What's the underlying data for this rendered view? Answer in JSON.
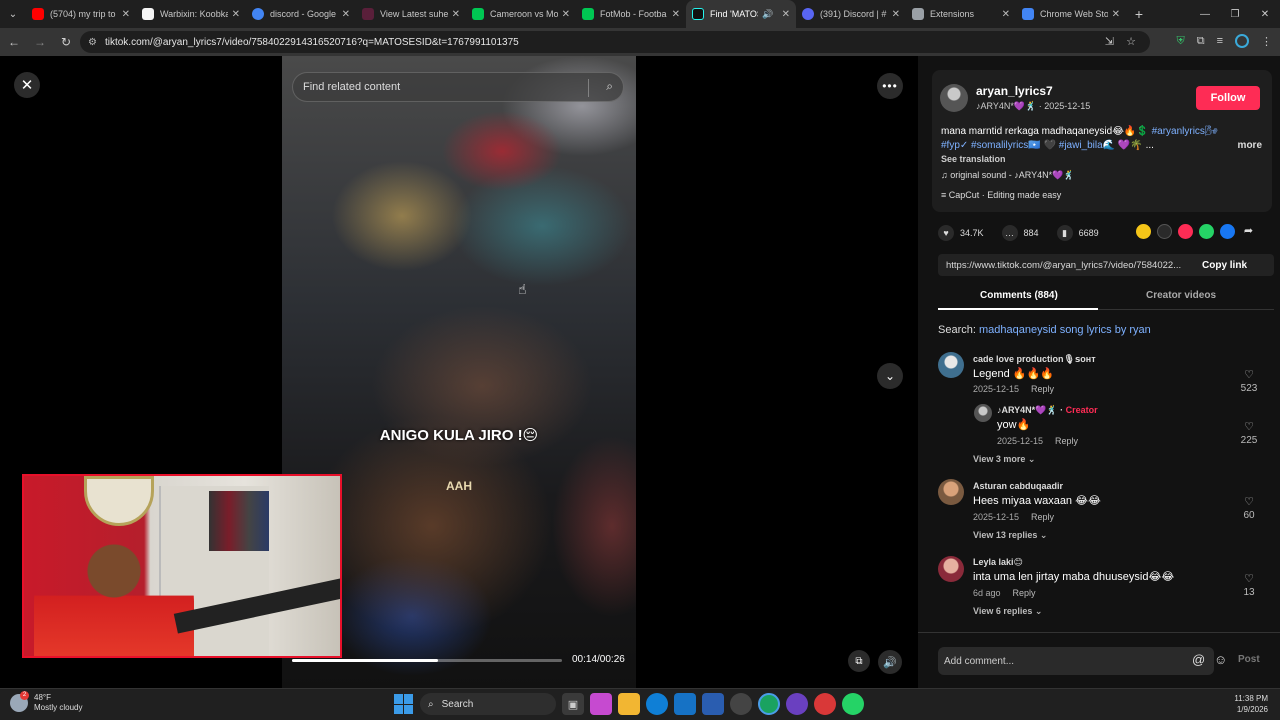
{
  "browser": {
    "tabs": [
      {
        "label": "(5704) my trip to",
        "color": "#ff0000",
        "active": false
      },
      {
        "label": "Warbixin: Koobka",
        "color": "#ffffff",
        "active": false
      },
      {
        "label": "discord - Google",
        "color": "#4285f4",
        "active": false
      },
      {
        "label": "View Latest suhey",
        "color": "#8a2be2",
        "active": false
      },
      {
        "label": "Cameroon vs Mo",
        "color": "#00c853",
        "active": false
      },
      {
        "label": "FotMob - Footba",
        "color": "#00c853",
        "active": false
      },
      {
        "label": "Find 'MATOSE",
        "color": "#111111",
        "active": true
      },
      {
        "label": "(391) Discord | #",
        "color": "#5865f2",
        "active": false
      },
      {
        "label": "Extensions",
        "color": "#9aa0a6",
        "active": false
      },
      {
        "label": "Chrome Web Sto",
        "color": "#4285f4",
        "active": false
      }
    ],
    "new_tab": "+",
    "url": "tiktok.com/@aryan_lyrics7/video/7584022914316520716?q=MATOSESID&t=1767991101375"
  },
  "video": {
    "search_placeholder": "Find related content",
    "caption": "ANIGO KULA JIRO !😔",
    "caption2": "AAH",
    "time": "00:14/00:26",
    "progress": 0.54
  },
  "post": {
    "author": "aryan_lyrics7",
    "author_sub": "♪ARY4N*💜🕺 · 2025-12-15",
    "follow": "Follow",
    "desc_line1": "mana marntid rerkaga madhaqaneysid😂🔥💲",
    "desc_tags1": "#aryanlyrics🌬",
    "desc_line2_tags": "#fyp✓ #somalilyrics🇸🇴",
    "desc_line2_mid": "🖤",
    "desc_line2_tags2": "#jawi_bila🌊",
    "desc_line2_end": "💜🌴 ...",
    "more": "more",
    "see_translation": "See translation",
    "sound": "♫  original sound - ♪ARY4N*💜🕺",
    "capcut": "≡  CapCut · Editing made easy",
    "likes": "34.7K",
    "comments": "884",
    "saves": "6689",
    "link": "https://www.tiktok.com/@aryan_lyrics7/video/7584022...",
    "copy_link": "Copy link"
  },
  "panel_tabs": {
    "comments": "Comments (884)",
    "creator_videos": "Creator videos"
  },
  "search_suggestion": {
    "prefix": "Search: ",
    "term": "madhaqaneysid song lyrics by ryan"
  },
  "comments": [
    {
      "name": "cade love production🎙ꜱᴏʜᴛ",
      "text": "Legend 🔥🔥🔥",
      "date": "2025-12-15",
      "reply": "Reply",
      "likes": "523"
    },
    {
      "name": "♪ARY4N*💜🕺 · ",
      "creator": "Creator",
      "text": "yow🔥",
      "date": "2025-12-15",
      "reply": "Reply",
      "likes": "225"
    },
    {
      "name": "Asturan cabduqaadir",
      "text": "Hees miyaa waxaan 😂😂",
      "date": "2025-12-15",
      "reply": "Reply",
      "likes": "60"
    },
    {
      "name": "Leyla laki😊",
      "text": "inta uma len jirtay maba dhuuseysid😂😂",
      "date": "6d ago",
      "reply": "Reply",
      "likes": "13"
    }
  ],
  "view_more": {
    "c1": "View 3 more ⌄",
    "c3": "View 13 replies ⌄",
    "c4": "View 6 replies ⌄"
  },
  "add_comment": {
    "placeholder": "Add comment...",
    "post": "Post"
  },
  "taskbar": {
    "temp": "48°F",
    "weather": "Mostly cloudy",
    "search": "Search",
    "time": "11:38 PM",
    "date": "1/9/2026",
    "weather_badge": "2"
  }
}
